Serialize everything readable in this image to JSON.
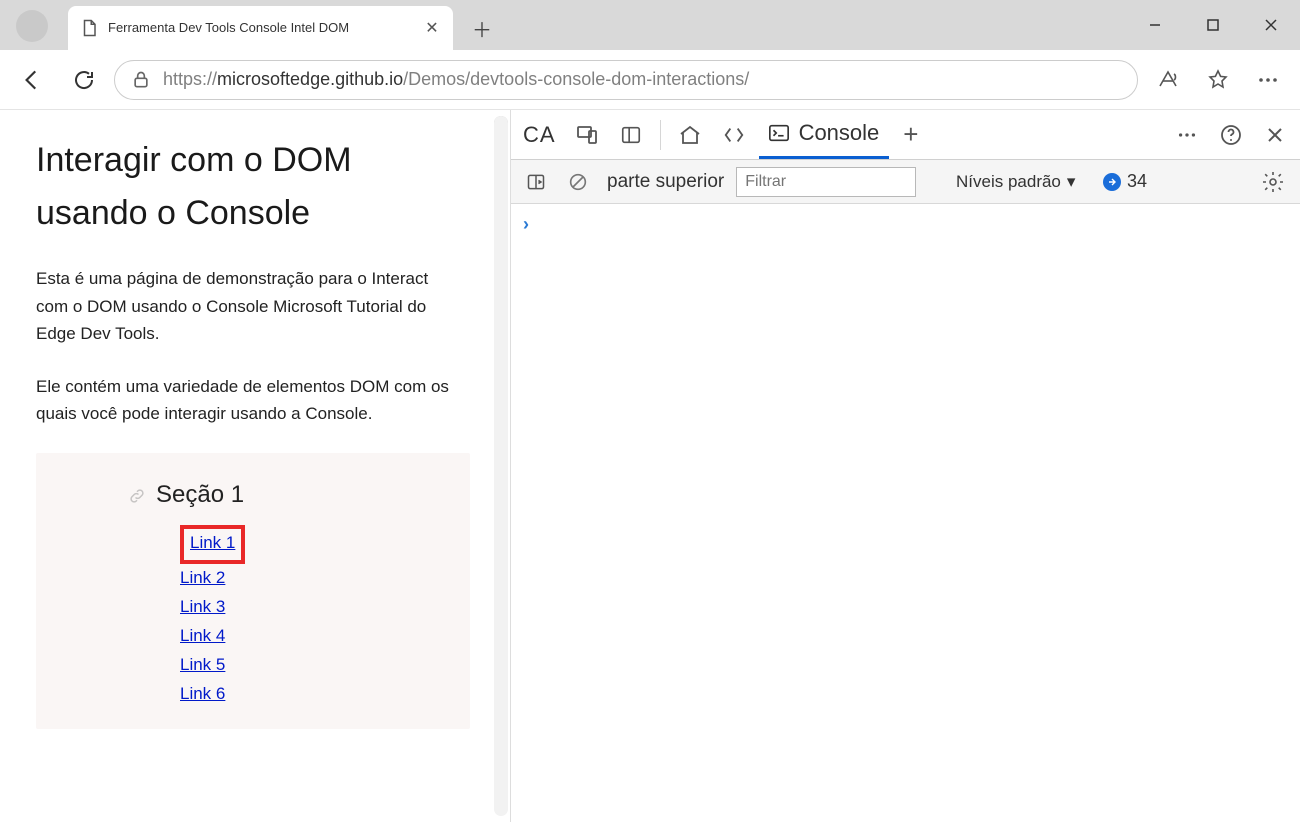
{
  "titlebar": {
    "tab_title": "Ferramenta Dev Tools Console   Intel DOM"
  },
  "addressbar": {
    "scheme": "https://",
    "host": "microsoftedge.github.io",
    "path": "/Demos/devtools-console-dom-interactions/"
  },
  "page": {
    "heading": "Interagir com o DOM usando o Console",
    "para1": "Esta é uma página de demonstração para o Interact com o DOM usando o Console Microsoft Tutorial do Edge Dev Tools.",
    "para2": "Ele contém uma variedade de elementos DOM com os quais você pode interagir usando a Console.",
    "section_title": "Seção 1",
    "links": [
      "Link 1",
      "Link 2",
      "Link 3",
      "Link 4",
      "Link 5",
      "Link 6"
    ]
  },
  "devtools": {
    "ca": "CA",
    "console_label": "Console",
    "context_label": "parte superior",
    "filter_placeholder": "Filtrar",
    "levels_label": "Níveis padrão",
    "issues_count": "34",
    "prompt": "›"
  }
}
